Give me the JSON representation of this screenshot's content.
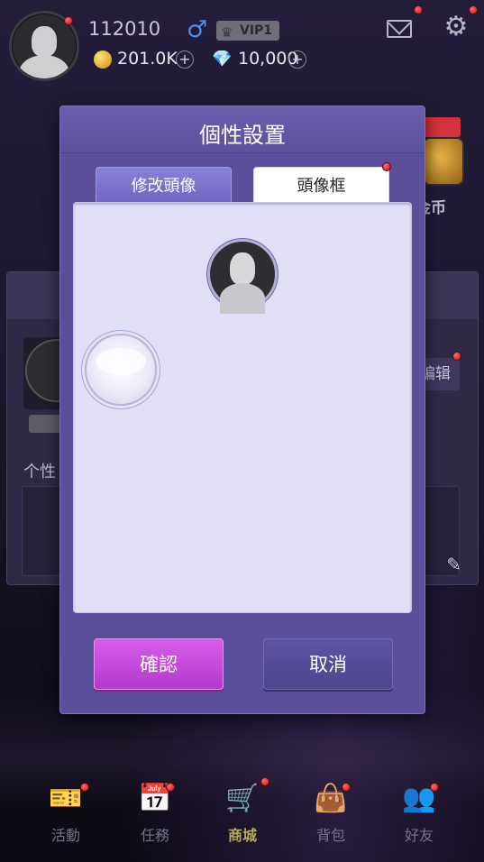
{
  "profile": {
    "uid": "112010",
    "gender_icon": "male-icon",
    "vip_label": "VIP1",
    "coins": "201.0K",
    "gems": "10,000"
  },
  "background": {
    "gold_label": "金币",
    "edit_label": "编辑",
    "signature_label": "个性"
  },
  "dialog": {
    "title": "個性設置",
    "tabs": [
      {
        "label": "修改頭像",
        "active": false
      },
      {
        "label": "頭像框",
        "active": true
      }
    ],
    "frames": [
      {
        "name": "default-avatar-frame",
        "selected": true
      },
      {
        "name": "white-ring-frame",
        "selected": false
      }
    ],
    "confirm_label": "確認",
    "cancel_label": "取消"
  },
  "nav": {
    "items": [
      {
        "label": "活動",
        "icon": "ticket-icon"
      },
      {
        "label": "任務",
        "icon": "calendar-icon"
      },
      {
        "label": "商城",
        "icon": "shop-cart-icon",
        "active": true
      },
      {
        "label": "背包",
        "icon": "bag-icon"
      },
      {
        "label": "好友",
        "icon": "friends-icon"
      }
    ]
  },
  "colors": {
    "dialog_bg": "#5b4f9c",
    "confirm_bg": "#c64cdc",
    "cancel_bg": "#544a99",
    "active_nav": "#b9a85c"
  }
}
